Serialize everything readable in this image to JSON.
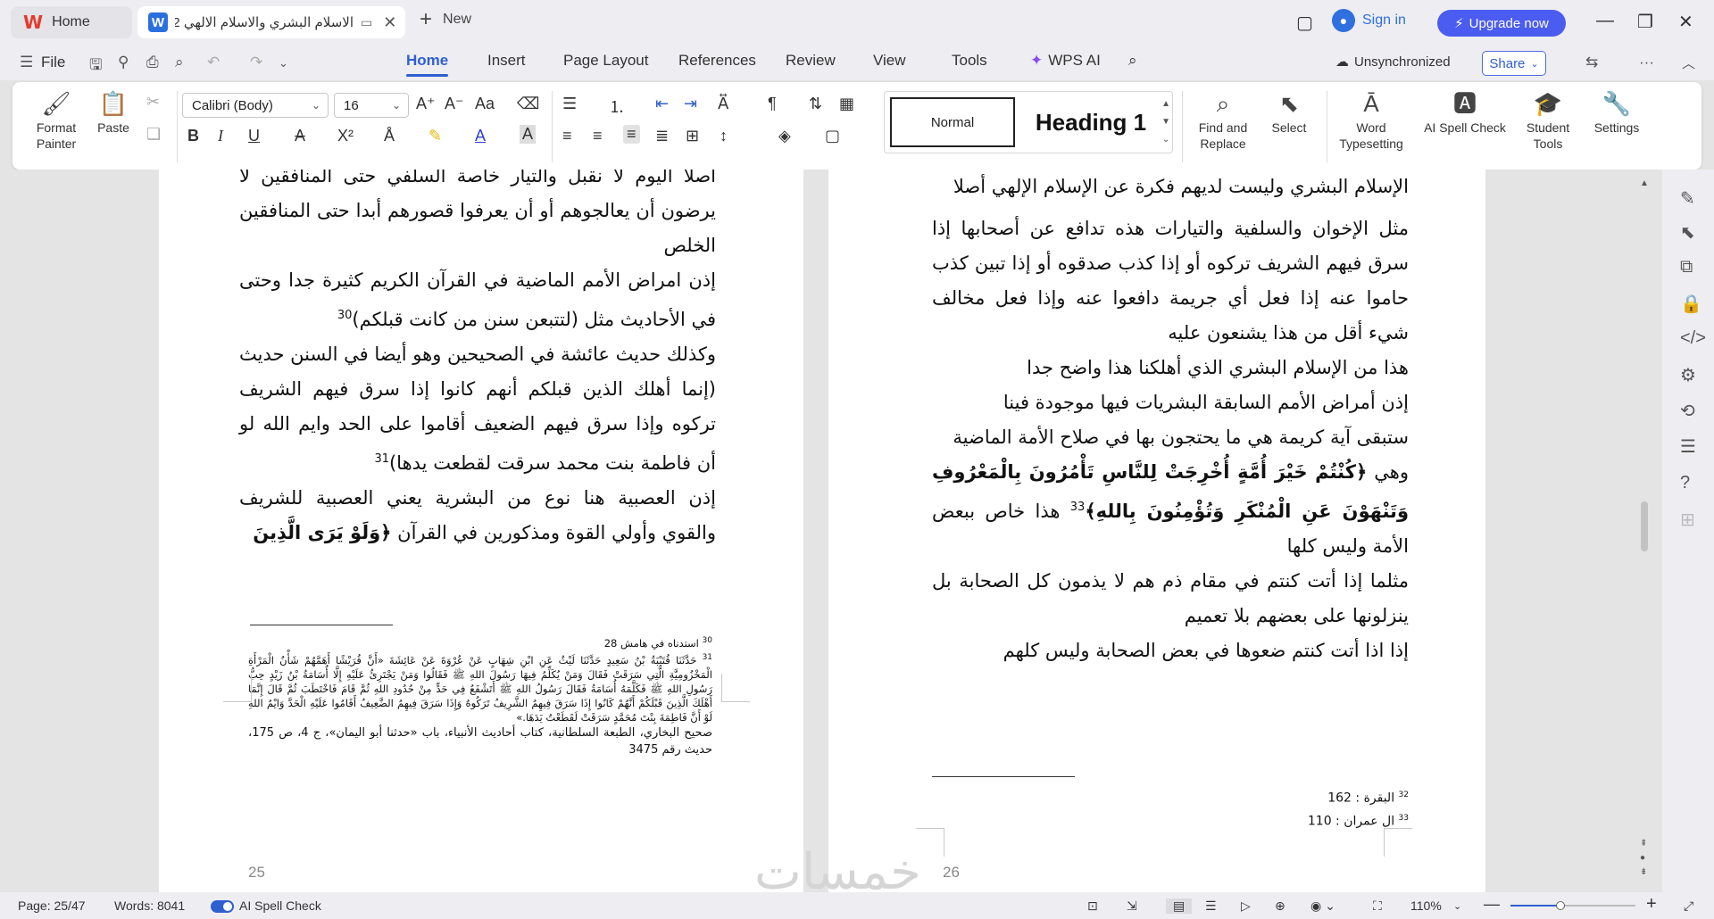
{
  "tabs": {
    "home_label": "Home",
    "doc_title": "الاسلام البشري والاسلام الالهي 2",
    "new_label": "New"
  },
  "titlebar": {
    "sign_in": "Sign in",
    "upgrade": "Upgrade now"
  },
  "menu": {
    "file": "File",
    "items": [
      "Home",
      "Insert",
      "Page Layout",
      "References",
      "Review",
      "View",
      "Tools"
    ],
    "wps_ai": "WPS AI",
    "unsync": "Unsynchronized",
    "share": "Share"
  },
  "ribbon": {
    "format_painter": "Format\nPainter",
    "format_painter_l1": "Format",
    "format_painter_l2": "Painter",
    "paste": "Paste",
    "font_name": "Calibri (Body)",
    "font_size": "16",
    "style_normal": "Normal",
    "style_heading1": "Heading 1",
    "find_replace_l1": "Find and",
    "find_replace_l2": "Replace",
    "select": "Select",
    "word_typesetting_l1": "Word",
    "word_typesetting_l2": "Typesetting",
    "ai_spell_check": "AI Spell Check",
    "student_tools_l1": "Student",
    "student_tools_l2": "Tools",
    "settings": "Settings"
  },
  "page25": {
    "lines": [
      "أصلا اليوم لا نقبل والتيار خاصة السلفي حتى المنافقين لا يرضون أن يعالجوهم أو أن يعرفوا قصورهم أبدا حتى المنافقين الخلص",
      "إذن امراض الأمم الماضية في القرآن الكريم كثيرة جدا وحتى في الأحاديث مثل (لتتبعن سنن من كانت قبلكم)",
      "وكذلك حديث عائشة في الصحيحين وهو أيضا في السنن حديث (إنما أهلك الذين قبلكم أنهم كانوا إذا سرق فيهم الشريف تركوه وإذا سرق فيهم الضعيف أقاموا على الحد وايم الله لو أن فاطمة بنت محمد سرقت لقطعت يدها)",
      "إذن العصبية هنا نوع من البشرية يعني العصبية للشريف والقوي وأولي القوة ومذكورين في القرآن",
      "﴿وَلَوْ يَرَى الَّذِينَ"
    ],
    "sup30": "30",
    "sup31": "31",
    "fn30": "استدناه في هامش 28",
    "fn31": "حَدَّثَنَا قُتَيْبَةُ بْنُ سَعِيدٍ حَدَّثَنَا لَيْثٌ عَنِ ابْنِ شِهَابٍ عَنْ عُرْوَةَ عَنْ عَائِشَةَ  «أَنَّ قُرَيْشًا أَهَمَّهُمْ شَأْنُ الْمَرْأَةِ الْمَخْزُومِيَّةِ الَّتِي سَرَقَتْ فَقَالَ وَمَنْ يُكَلِّمُ فِيهَا رَسُولَ اللهِ ﷺ فَقَالُوا وَمَنْ يَجْتَرِئُ عَلَيْهِ إِلَّا أُسَامَةُ بْنُ زَيْدٍ حِبُّ رَسُولِ اللهِ ﷺ فَكَلَّمَهُ أُسَامَةُ فَقَالَ رَسُولُ اللهِ ﷺ أَتَشْفَعُ فِي حَدٍّ مِنْ حُدُودِ اللهِ ثُمَّ قَامَ فَاخْتَطَبَ ثُمَّ قَالَ إِنَّمَا أَهْلَكَ الَّذِينَ قَبْلَكُمْ أَنَّهُمْ كَانُوا إِذَا سَرَقَ فِيهِمُ الشَّرِيفُ تَرَكُوهُ وَإِذَا سَرَقَ فِيهِمُ الضَّعِيفُ أَقَامُوا عَلَيْهِ الْحَدَّ وَايْمُ اللهِ لَوْ أَنَّ فَاطِمَةَ بِنْتَ مُحَمَّدٍ سَرَقَتْ لَقَطَعْتُ يَدَهَا.»",
    "fn31_src": "صحيح البخاري، الطبعة السلطانية، كتاب أحاديث الأنبياء، باب «حدثنا أبو اليمان»، ج 4، ص 175، حديث رقم 3475",
    "page_no": "25"
  },
  "page26": {
    "lines": [
      "الإسلام البشري وليست لديهم فكرة عن الإسلام الإلهي أصلا",
      "مثل الإخوان والسلفية والتيارات هذه تدافع عن أصحابها إذا سرق فيهم الشريف تركوه أو إذا كذب صدقوه أو إذا تبين كذب حاموا عنه إذا فعل أي جريمة دافعوا عنه وإذا فعل مخالف شيء أقل من هذا يشنعون عليه",
      "هذا من الإسلام البشري الذي أهلكنا هذا واضح جدا",
      "إذن أمراض الأمم السابقة البشريات فيها موجودة فينا",
      "ستبقى آية كريمة هي ما يحتجون بها في صلاح الأمة الماضية",
      "وهي",
      "﴿كُنْتُمْ خَيْرَ أُمَّةٍ أُخْرِجَتْ لِلنَّاسِ تَأْمُرُونَ بِالْمَعْرُوفِ وَتَنْهَوْنَ عَنِ الْمُنْكَرِ وَتُؤْمِنُونَ بِاللهِ﴾",
      "هذا خاص ببعض الأمة وليس كلها",
      "مثلما إذا أتت كنتم في مقام ذم هم لا يذمون كل الصحابة بل ينزلونها على بعضهم بلا تعميم",
      "إذا اذا أتت كنتم ضعوها في بعض الصحابة وليس كلهم"
    ],
    "sup33": "33",
    "fn32": "البقرة : 162",
    "fn33": "ال عمران : 110",
    "sup32_label": "32",
    "sup33_label": "33",
    "page_no": "26"
  },
  "watermark": "خمسات",
  "statusbar": {
    "page": "Page: 25/47",
    "words": "Words: 8041",
    "spell": "AI Spell Check",
    "zoom": "110%",
    "zoom_fraction": 0.4
  },
  "colors": {
    "accent": "#2f5fd0",
    "upgrade": "#4b5cf0",
    "wps_red": "#e33b2e"
  }
}
